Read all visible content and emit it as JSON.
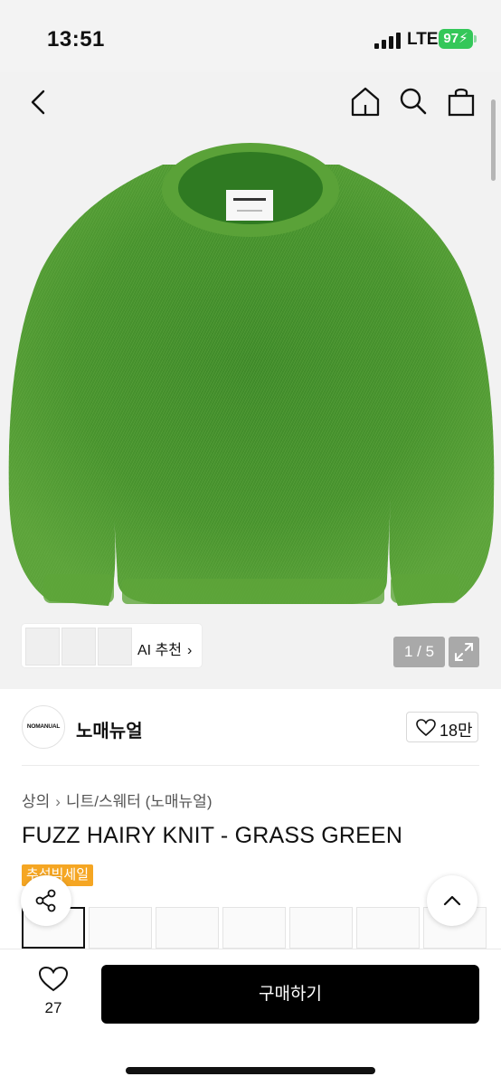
{
  "status": {
    "time": "13:51",
    "network": "LTE",
    "battery": "97"
  },
  "hero": {
    "page_counter": "1 / 5",
    "ai_recommend_label": "AI 추천"
  },
  "brand": {
    "logo_text": "NOMANUAL",
    "name": "노매뉴얼",
    "likes": "18만"
  },
  "breadcrumb": {
    "level1": "상의",
    "level2": "니트/스웨터 (노매뉴얼)"
  },
  "product": {
    "title": "FUZZ HAIRY KNIT - GRASS GREEN",
    "badge": "추석빅세일"
  },
  "bottom": {
    "wish_count": "27",
    "buy_label": "구매하기"
  },
  "colors": {
    "sweater_green": "#4a8f2c",
    "badge_orange": "#f5a623",
    "buy_button": "#000000"
  },
  "icons": [
    "back-arrow-icon",
    "home-icon",
    "search-icon",
    "shopping-bag-icon",
    "chevron-right-icon",
    "expand-icon",
    "heart-icon",
    "share-icon",
    "chevron-up-icon"
  ]
}
